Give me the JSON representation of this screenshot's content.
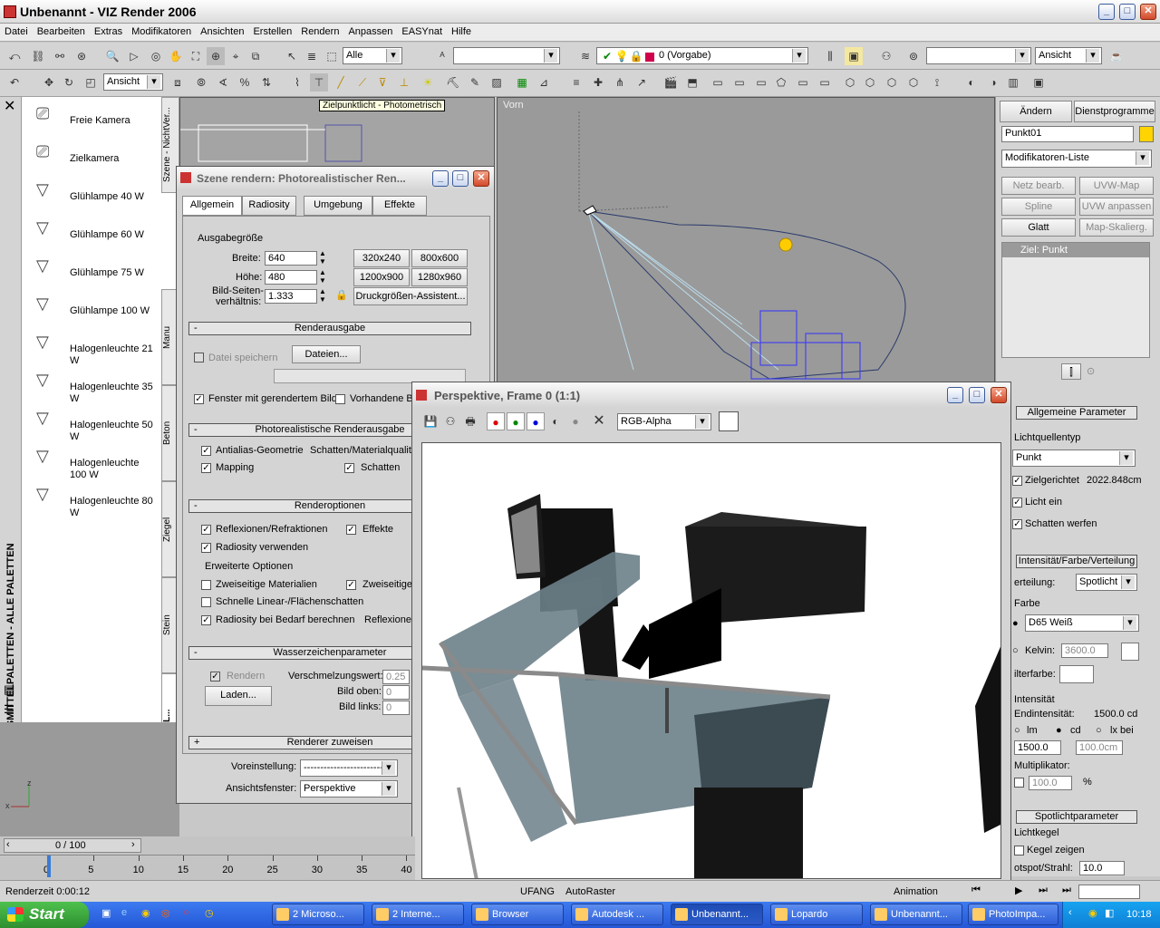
{
  "app": {
    "title": "Unbenannt - VIZ Render 2006"
  },
  "menu": [
    "Datei",
    "Bearbeiten",
    "Extras",
    "Modifikatoren",
    "Ansichten",
    "Erstellen",
    "Rendern",
    "Anpassen",
    "EASYnat",
    "Hilfe"
  ],
  "toolbar": {
    "filter": "Alle",
    "layer": "0 (Vorgabe)",
    "view_right": "Ansicht",
    "view_left": "Ansicht",
    "tooltip": "Zielpunktlicht - Photometrisch"
  },
  "palette": {
    "side_label": "HILFSMITTELPALETTEN - ALLE PALETTEN",
    "items": [
      "Freie Kamera",
      "Zielkamera",
      "Glühlampe 40 W",
      "Glühlampe 60 W",
      "Glühlampe 75 W",
      "Glühlampe 100 W",
      "Halogenleuchte 21 W",
      "Halogenleuchte 35 W",
      "Halogenleuchte 50 W",
      "Halogenleuchte 100 W",
      "Halogenleuchte 80 W"
    ],
    "tabs": [
      "Szene - NichtVer...",
      "Manu",
      "Beton",
      "Ziegel",
      "Stein",
      "Kameras und L..."
    ]
  },
  "viewport": {
    "label": "Vorn"
  },
  "render_dialog": {
    "title": "Szene rendern: Photorealistischer Ren...",
    "tabs": [
      "Allgemein",
      "Radiosity",
      "Umgebung",
      "Effekte"
    ],
    "output_size": "Ausgabegröße",
    "width_label": "Breite:",
    "width": "640",
    "height_label": "Höhe:",
    "height": "480",
    "aspect_label": "Bild-Seiten-",
    "aspect_label2": "verhältnis:",
    "aspect": "1.333",
    "presets": [
      "320x240",
      "800x600",
      "1200x900",
      "1280x960"
    ],
    "print_assist": "Druckgrößen-Assistent...",
    "sec_output": "Renderausgabe",
    "save_file": "Datei speichern",
    "files": "Dateien...",
    "window": "Fenster mit gerendertem Bild",
    "frame": "Vorhandene B",
    "sec_photo": "Photorealistische Renderausgabe",
    "antialias": "Antialias-Geometrie",
    "shadows_mat": "Schatten/Materialqualit",
    "mapping": "Mapping",
    "shadows": "Schatten",
    "sec_options": "Renderoptionen",
    "reflect": "Reflexionen/Refraktionen",
    "effects": "Effekte",
    "radiosity": "Radiosity verwenden",
    "adv": "Erweiterte Optionen",
    "twosided": "Zweiseitige Materialien",
    "twosided2": "Zweiseitige",
    "fast": "Schnelle Linear-/Flächenschatten",
    "radbed": "Radiosity bei Bedarf berechnen",
    "reflexione": "Reflexione",
    "sec_water": "Wasserzeichenparameter",
    "render": "Rendern",
    "blend": "Verschmelzungswert:",
    "blend_v": "0.25",
    "load": "Laden...",
    "img_top": "Bild oben:",
    "img_top_v": "0",
    "img_left": "Bild links:",
    "img_left_v": "0",
    "sec_renderer": "Renderer zuweisen",
    "preset_label": "Voreinstellung:",
    "preset_v": "-------------------------",
    "viewwin_label": "Ansichtsfenster:",
    "viewwin_v": "Perspektive"
  },
  "frame_window": {
    "title": "Perspektive, Frame 0 (1:1)",
    "channel": "RGB-Alpha"
  },
  "cmd_panel": {
    "tab_modify": "Ändern",
    "tab_util": "Dienstprogramme",
    "name": "Punkt01",
    "modlist": "Modifikatoren-Liste",
    "btns": [
      "Netz bearb.",
      "UVW-Map",
      "Spline bearbeiten",
      "UVW anpassen",
      "Glatt",
      "Map-Skalierg."
    ],
    "stack_item": "Ziel: Punkt",
    "gen_params": "Allgemeine Parameter",
    "lighttype": "Lichtquellentyp",
    "type_v": "Punkt",
    "target": "Zielgerichtet",
    "target_dist": "2022.848cm",
    "light_on": "Licht ein",
    "cast_shadows": "Schatten werfen",
    "ifd": "Intensität/Farbe/Verteilung",
    "dist_label": "erteilung:",
    "dist_v": "Spotlicht",
    "color": "Farbe",
    "color_v": "D65 Weiß",
    "kelvin": "Kelvin:",
    "kelvin_v": "3600.0",
    "filter": "ilterfarbe:",
    "intensity": "Intensität",
    "res_int": "Endintensität:",
    "res_int_v": "1500.0 cd",
    "lm": "lm",
    "cd": "cd",
    "lx": "lx bei",
    "int_v": "1500.0",
    "dist2": "100.0cm",
    "mult": "Multiplikator:",
    "mult_v": "100.0",
    "pct": "%",
    "spot": "Spotlichtparameter",
    "cone": "Lichtkegel",
    "show_cone": "Kegel zeigen",
    "hotspot": "otspot/Strahl:",
    "hotspot_v": "10.0"
  },
  "timeline": {
    "counter": "0 / 100",
    "ticks": [
      "0",
      "5",
      "10",
      "15",
      "20",
      "25",
      "30",
      "35",
      "40"
    ]
  },
  "status": {
    "render_time": "Renderzeit  0:00:12",
    "mode1": "UFANG",
    "mode2": "AutoRaster",
    "anim": "Animation"
  },
  "taskbar": {
    "start": "Start",
    "items": [
      "2 Microso...",
      "2 Interne...",
      "Browser",
      "Autodesk ...",
      "Unbenannt...",
      "Lopardo",
      "Unbenannt...",
      "PhotoImpa..."
    ],
    "clock": "10:18"
  }
}
